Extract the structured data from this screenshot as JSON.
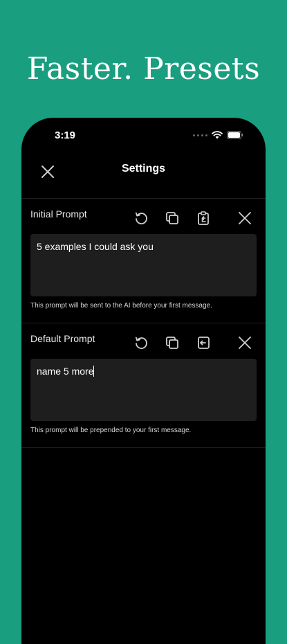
{
  "headline": "Faster. Presets",
  "status_bar": {
    "time": "3:19"
  },
  "nav": {
    "title": "Settings"
  },
  "sections": [
    {
      "title": "Initial Prompt",
      "value": "5 examples I could ask you",
      "helper": "This prompt will be sent to the AI before your first message."
    },
    {
      "title": "Default Prompt",
      "value": "name 5 more",
      "helper": "This prompt will be prepended to your first message."
    }
  ],
  "icons": {
    "close": "close-icon",
    "reset": "reset-icon",
    "copy": "copy-icon",
    "paste": "paste-icon",
    "insert": "insert-icon",
    "clear": "clear-icon"
  }
}
